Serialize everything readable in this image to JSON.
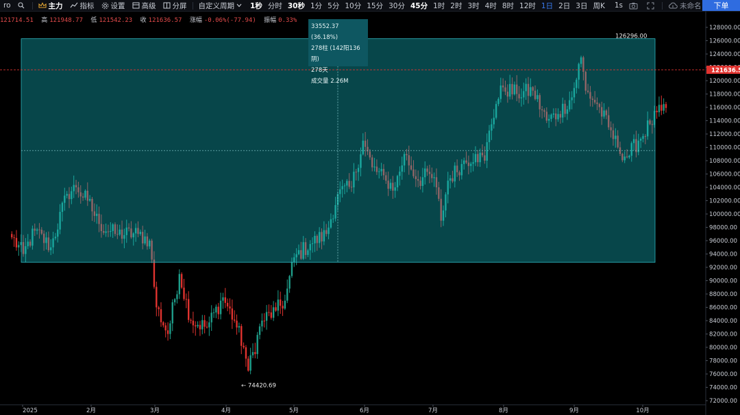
{
  "toolbar": {
    "left_fragment": "ro",
    "main_label": "主力",
    "indicator_label": "指标",
    "settings_label": "设置",
    "advanced_label": "高级",
    "split_label": "分屏",
    "custom_period_label": "自定义周期",
    "periods": [
      "1秒",
      "分时",
      "30秒",
      "1分",
      "5分",
      "10分",
      "15分",
      "30分",
      "45分",
      "1时",
      "2时",
      "3时",
      "4时",
      "8时",
      "12时",
      "1日",
      "2日",
      "3日",
      "周K"
    ],
    "bold_periods": [
      "1秒",
      "30秒",
      "45分"
    ],
    "active_period": "1日",
    "extra_period": "1s",
    "layout_name": "未命名",
    "order_button": "下单"
  },
  "ohlc": {
    "open": "121714.51",
    "high_label": "高",
    "high": "121948.77",
    "low_label": "低",
    "low": "121542.23",
    "close_label": "收",
    "close": "121636.57",
    "change_label": "涨幅",
    "change": "-0.06%(-77.94)",
    "amplitude_label": "振幅",
    "amplitude": "0.33%"
  },
  "measure": {
    "line1": "33552.37 (36.18%)",
    "line2": "278柱 (142阳136阴)",
    "line3": "278天",
    "line4": "成交量 2.26M"
  },
  "markers": {
    "high_label": "126296.00",
    "low_label": "← 74420.69",
    "current_price": "121636.57"
  },
  "colors": {
    "up": "#1f9e8a",
    "down": "#e0332f",
    "measure_fill": "#0e5761",
    "current_price_bg": "#e0332f",
    "active": "#3a7cf0"
  },
  "chart_data": {
    "type": "candlestick",
    "y_ticks": [
      72000,
      74000,
      76000,
      78000,
      80000,
      82000,
      84000,
      86000,
      88000,
      90000,
      92000,
      94000,
      96000,
      98000,
      100000,
      102000,
      104000,
      106000,
      108000,
      110000,
      112000,
      114000,
      116000,
      118000,
      120000,
      122000,
      124000,
      126000,
      128000
    ],
    "y_tick_labels": [
      "72000.00",
      "74000.00",
      "76000.00",
      "78000.00",
      "80000.00",
      "82000.00",
      "84000.00",
      "86000.00",
      "88000.00",
      "90000.00",
      "92000.00",
      "94000.00",
      "96000.00",
      "98000.00",
      "100000.00",
      "102000.00",
      "104000.00",
      "106000.00",
      "108000.00",
      "110000.00",
      "112000.00",
      "114000.00",
      "116000.00",
      "118000.00",
      "120000.00",
      "122000.00",
      "124000.00",
      "126000.00",
      "128000.00"
    ],
    "x_labels": [
      "2025",
      "2月",
      "3月",
      "4月",
      "5月",
      "6月",
      "7月",
      "8月",
      "9月",
      "10月"
    ],
    "ylim": [
      71000,
      130000
    ],
    "current_price": 121636.57,
    "range_high": 126296.0,
    "range_low": 74420.69,
    "measure_from": 92744,
    "measure_to": 126296,
    "grid": false,
    "anchors": [
      {
        "day": -5,
        "close": 96500
      },
      {
        "day": 0,
        "close": 94000
      },
      {
        "day": 5,
        "close": 97500
      },
      {
        "day": 12,
        "close": 95000
      },
      {
        "day": 19,
        "close": 103000
      },
      {
        "day": 23,
        "close": 104000
      },
      {
        "day": 28,
        "close": 102000
      },
      {
        "day": 33,
        "close": 98500
      },
      {
        "day": 40,
        "close": 97000
      },
      {
        "day": 50,
        "close": 97000
      },
      {
        "day": 55,
        "close": 96000
      },
      {
        "day": 58,
        "close": 86000
      },
      {
        "day": 63,
        "close": 82000
      },
      {
        "day": 68,
        "close": 91000
      },
      {
        "day": 73,
        "close": 84000
      },
      {
        "day": 80,
        "close": 83000
      },
      {
        "day": 87,
        "close": 87500
      },
      {
        "day": 92,
        "close": 84000
      },
      {
        "day": 96,
        "close": 80000
      },
      {
        "day": 98,
        "close": 76500
      },
      {
        "day": 104,
        "close": 84000
      },
      {
        "day": 110,
        "close": 85500
      },
      {
        "day": 114,
        "close": 87000
      },
      {
        "day": 118,
        "close": 93500
      },
      {
        "day": 125,
        "close": 95500
      },
      {
        "day": 132,
        "close": 97000
      },
      {
        "day": 137,
        "close": 103000
      },
      {
        "day": 143,
        "close": 104000
      },
      {
        "day": 148,
        "close": 111000
      },
      {
        "day": 152,
        "close": 107000
      },
      {
        "day": 158,
        "close": 105000
      },
      {
        "day": 162,
        "close": 104000
      },
      {
        "day": 166,
        "close": 109000
      },
      {
        "day": 172,
        "close": 105000
      },
      {
        "day": 177,
        "close": 106000
      },
      {
        "day": 180,
        "close": 104000
      },
      {
        "day": 182,
        "close": 99000
      },
      {
        "day": 185,
        "close": 105000
      },
      {
        "day": 191,
        "close": 107500
      },
      {
        "day": 197,
        "close": 109000
      },
      {
        "day": 201,
        "close": 108000
      },
      {
        "day": 203,
        "close": 112500
      },
      {
        "day": 206,
        "close": 116500
      },
      {
        "day": 209,
        "close": 119000
      },
      {
        "day": 215,
        "close": 118000
      },
      {
        "day": 222,
        "close": 118500
      },
      {
        "day": 228,
        "close": 114000
      },
      {
        "day": 233,
        "close": 115000
      },
      {
        "day": 239,
        "close": 117500
      },
      {
        "day": 243,
        "close": 123500
      },
      {
        "day": 245,
        "close": 118500
      },
      {
        "day": 250,
        "close": 116500
      },
      {
        "day": 255,
        "close": 113000
      },
      {
        "day": 259,
        "close": 110000
      },
      {
        "day": 263,
        "close": 108500
      },
      {
        "day": 268,
        "close": 111000
      },
      {
        "day": 273,
        "close": 113500
      },
      {
        "day": 278,
        "close": 115500
      },
      {
        "day": 284,
        "close": 117000
      },
      {
        "day": 288,
        "close": 112000
      },
      {
        "day": 291,
        "close": 109000
      },
      {
        "day": 294,
        "close": 113000
      },
      {
        "day": 297,
        "close": 118500
      },
      {
        "day": 300,
        "close": 124500
      },
      {
        "day": 304,
        "close": 124000
      },
      {
        "day": 306,
        "close": 121636.57
      }
    ]
  }
}
